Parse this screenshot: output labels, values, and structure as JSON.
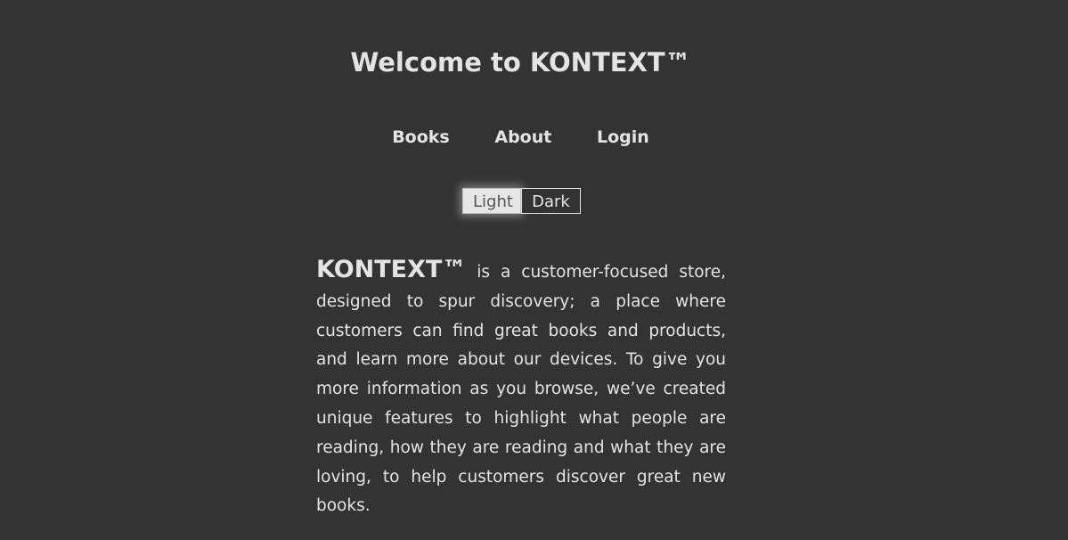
{
  "header": {
    "title": "Welcome to KONTEXT™"
  },
  "nav": {
    "items": [
      {
        "label": "Books"
      },
      {
        "label": "About"
      },
      {
        "label": "Login"
      }
    ]
  },
  "theme_toggle": {
    "light_label": "Light",
    "dark_label": "Dark",
    "selected": "Light"
  },
  "intro": {
    "brand": "KONTEXT™",
    "text": " is a customer-focused store, designed to spur discovery; a place where customers can find great books and products, and learn more about our devices. To give you more information as you browse, we’ve created unique features to highlight what people are reading, how they are reading and what they are loving, to help customers discover great new books."
  },
  "colors": {
    "background": "#333333",
    "text": "#e4e4e4",
    "light_button_bg": "#e6e6e6"
  }
}
